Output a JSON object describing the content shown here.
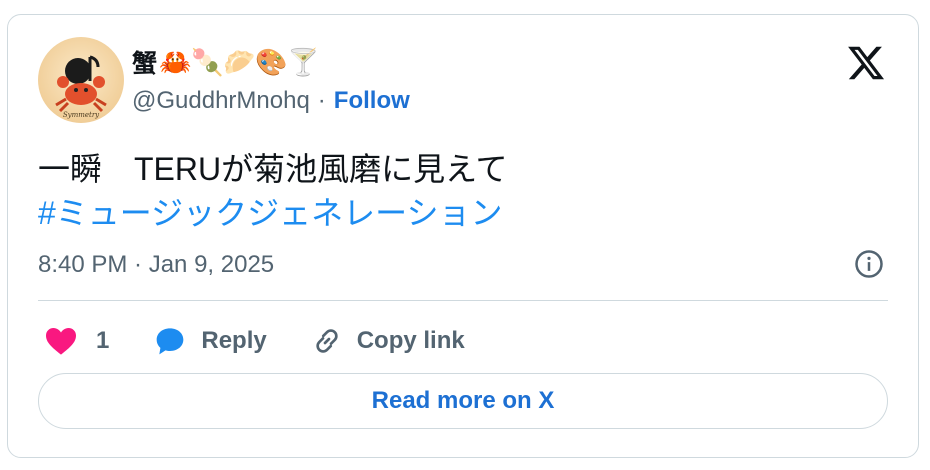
{
  "author": {
    "display_name": "蟹",
    "name_emojis": [
      "🦀",
      "🍡",
      "🥟",
      "🎨",
      "🍸"
    ],
    "handle": "@GuddhrMnohq",
    "separator": "·",
    "follow_label": "Follow",
    "avatar_text": "Symmetry"
  },
  "brand_icon": "x-logo-icon",
  "tweet": {
    "text": "一瞬　TERUが菊池風磨に見えて",
    "hashtag": "#ミュージックジェネレーション"
  },
  "timestamp": "8:40 PM · Jan 9, 2025",
  "actions": {
    "like_count": "1",
    "reply_label": "Reply",
    "copy_link_label": "Copy link"
  },
  "read_more_label": "Read more on X",
  "colors": {
    "link_blue": "#1d70d3",
    "hashtag_blue": "#1d8cf0",
    "heart_pink": "#f91880",
    "muted": "#536471",
    "border": "#cfd9de"
  }
}
